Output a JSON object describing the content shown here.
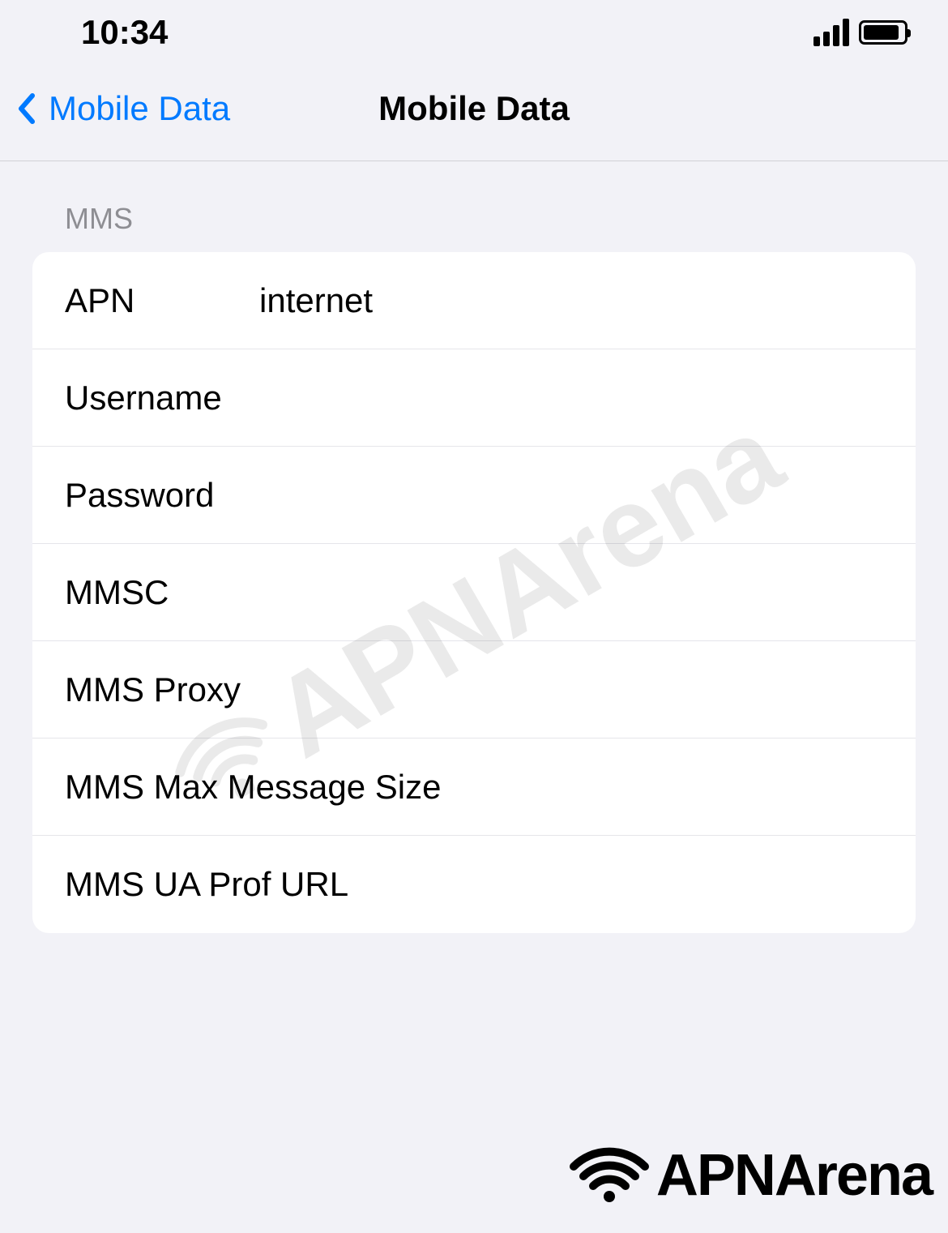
{
  "status": {
    "time": "10:34"
  },
  "nav": {
    "back_label": "Mobile Data",
    "title": "Mobile Data"
  },
  "section": {
    "header": "MMS",
    "rows": [
      {
        "label": "APN",
        "value": "internet"
      },
      {
        "label": "Username",
        "value": ""
      },
      {
        "label": "Password",
        "value": ""
      },
      {
        "label": "MMSC",
        "value": ""
      },
      {
        "label": "MMS Proxy",
        "value": ""
      },
      {
        "label": "MMS Max Message Size",
        "value": ""
      },
      {
        "label": "MMS UA Prof URL",
        "value": ""
      }
    ]
  },
  "brand": "APNArena"
}
